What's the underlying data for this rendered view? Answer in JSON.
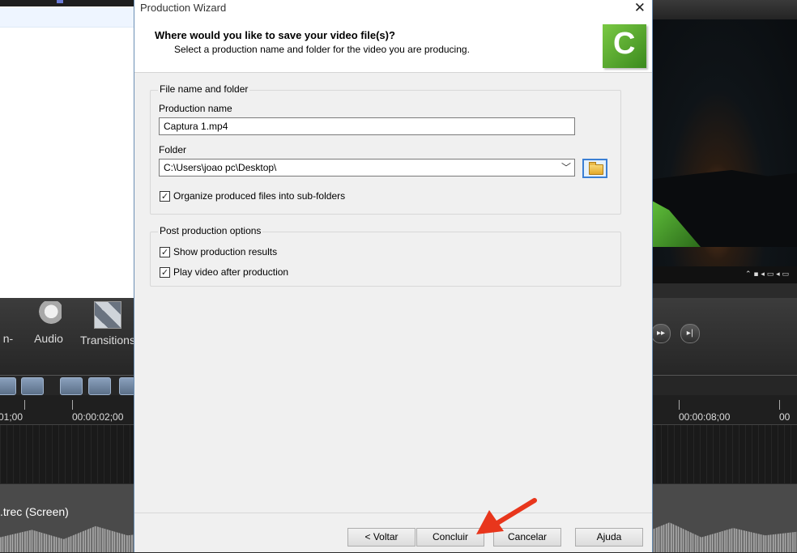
{
  "background_app": {
    "toolbar": {
      "partial_tool_label": "n-",
      "audio_label": "Audio",
      "transitions_label": "Transitions"
    },
    "timeline": {
      "ticks": [
        "01;00",
        "00:00:02;00",
        "00:00:08;00",
        "00"
      ],
      "clip_label": ".trec (Screen)"
    }
  },
  "dialog": {
    "title": "Production Wizard",
    "close_glyph": "✕",
    "header_title": "Where would you like to save your video file(s)?",
    "header_subtitle": "Select a production name and folder for the video you are producing.",
    "logo_letter": "C",
    "file_group": {
      "legend": "File name and folder",
      "production_name_label": "Production name",
      "production_name_value": "Captura 1.mp4",
      "folder_label": "Folder",
      "folder_value": "C:\\Users\\joao pc\\Desktop\\",
      "organize_label": "Organize produced files into sub-folders",
      "organize_checked": true
    },
    "post_group": {
      "legend": "Post production options",
      "show_results_label": "Show production results",
      "show_results_checked": true,
      "play_video_label": "Play video after production",
      "play_video_checked": true
    },
    "buttons": {
      "back": "< Voltar",
      "finish": "Concluir",
      "cancel": "Cancelar",
      "help": "Ajuda"
    }
  },
  "colors": {
    "annotation_arrow": "#e8361c",
    "logo_green": "#5aa82c",
    "focus_blue": "#3b7fd4"
  }
}
